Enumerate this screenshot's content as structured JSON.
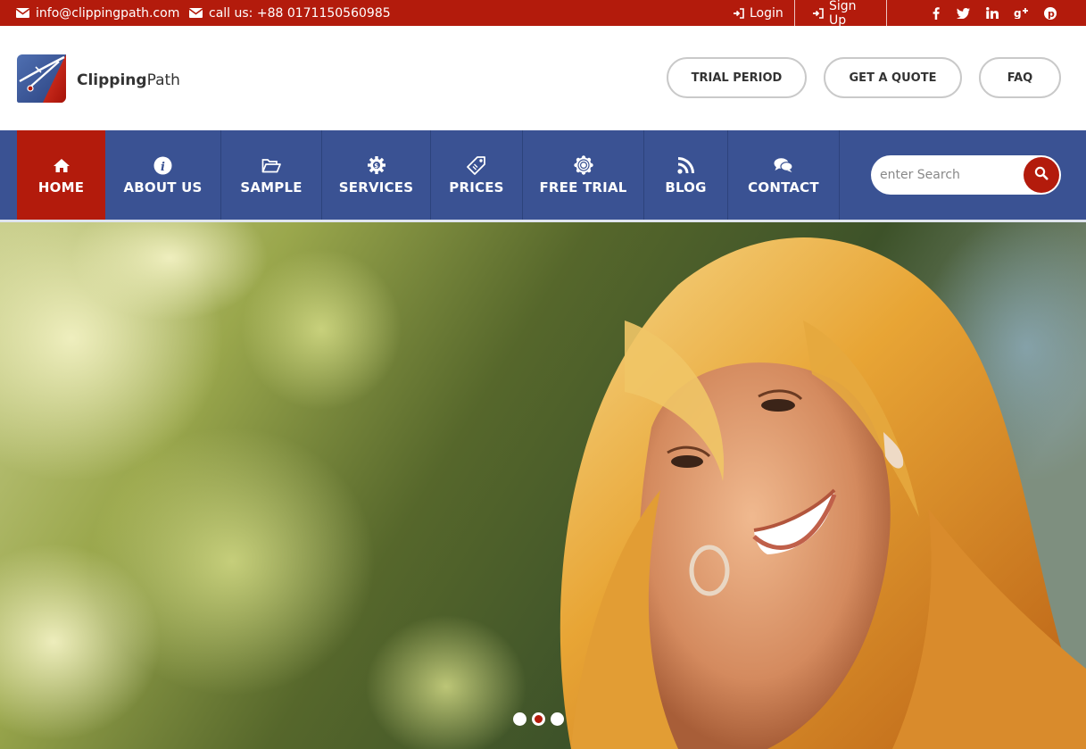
{
  "topbar": {
    "email": "info@clippingpath.com",
    "phone": "call us: +88 0171150560985",
    "login": "Login",
    "signup": "Sign Up",
    "social": [
      {
        "icon": "facebook-icon",
        "glyph": "f"
      },
      {
        "icon": "twitter-icon",
        "glyph": "t"
      },
      {
        "icon": "linkedin-icon",
        "glyph": "in"
      },
      {
        "icon": "google-plus-icon",
        "glyph": "g+"
      },
      {
        "icon": "pinterest-icon",
        "glyph": "p"
      }
    ]
  },
  "header": {
    "logo_bold": "Clipping",
    "logo_light": "Path",
    "buttons": [
      "TRIAL PERIOD",
      "GET A QUOTE",
      "FAQ"
    ]
  },
  "nav": {
    "items": [
      {
        "label": "HOME",
        "icon": "home-icon",
        "active": true
      },
      {
        "label": "ABOUT US",
        "icon": "info-icon"
      },
      {
        "label": "SAMPLE",
        "icon": "folder-open-icon"
      },
      {
        "label": "SERVICES",
        "icon": "gear-icon"
      },
      {
        "label": "PRICES",
        "icon": "price-tag-icon"
      },
      {
        "label": "FREE TRIAL",
        "icon": "badge-icon"
      },
      {
        "label": "BLOG",
        "icon": "rss-icon"
      },
      {
        "label": "CONTACT",
        "icon": "chat-icon"
      }
    ],
    "search_placeholder": "enter Search"
  },
  "hero": {
    "slides": 3,
    "active_slide": 2
  },
  "colors": {
    "brand_red": "#b31b0c",
    "nav_blue": "#3a5293"
  }
}
